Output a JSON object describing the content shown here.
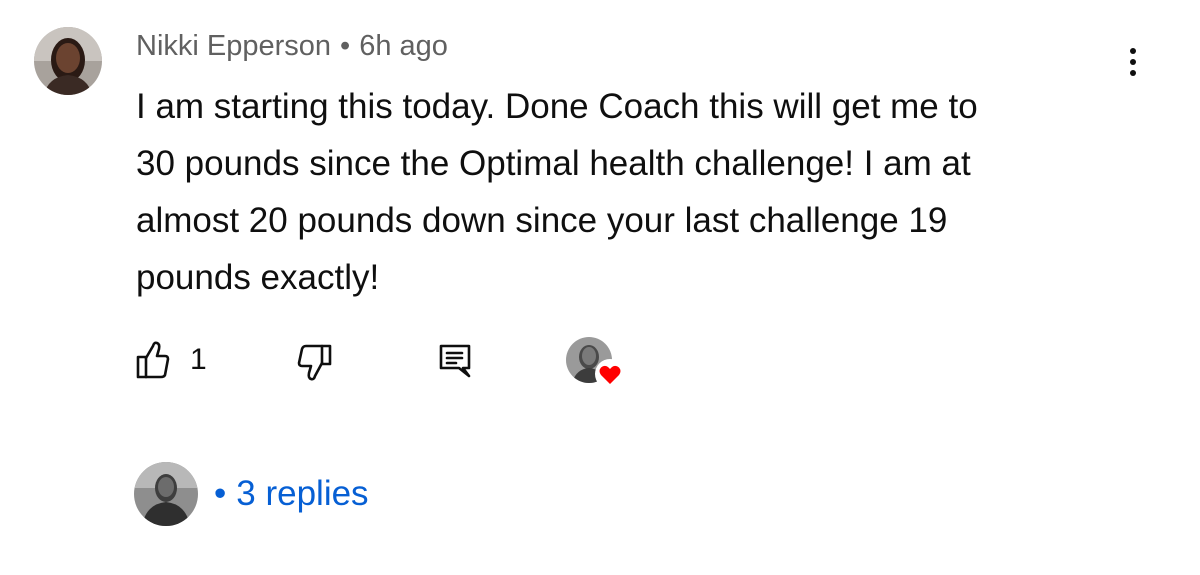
{
  "comment": {
    "author": "Nikki Epperson",
    "separator": "•",
    "time": "6h ago",
    "text_lines": [
      "I am starting this today. Done Coach this will get me to",
      "30 pounds since the Optimal health challenge! I am at",
      "almost 20 pounds down since your last challenge 19",
      "pounds exactly!"
    ]
  },
  "actions": {
    "like_count": "1",
    "like_icon": "thumbs-up-icon",
    "dislike_icon": "thumbs-down-icon",
    "reply_icon": "reply-comment-icon",
    "creator_heart_icon": "heart-icon"
  },
  "replies": {
    "separator": "•",
    "label": "3 replies"
  },
  "colors": {
    "meta_text": "#606060",
    "body_text": "#0f0f0f",
    "link_blue": "#065fd4",
    "heart_red": "#ff0000"
  }
}
